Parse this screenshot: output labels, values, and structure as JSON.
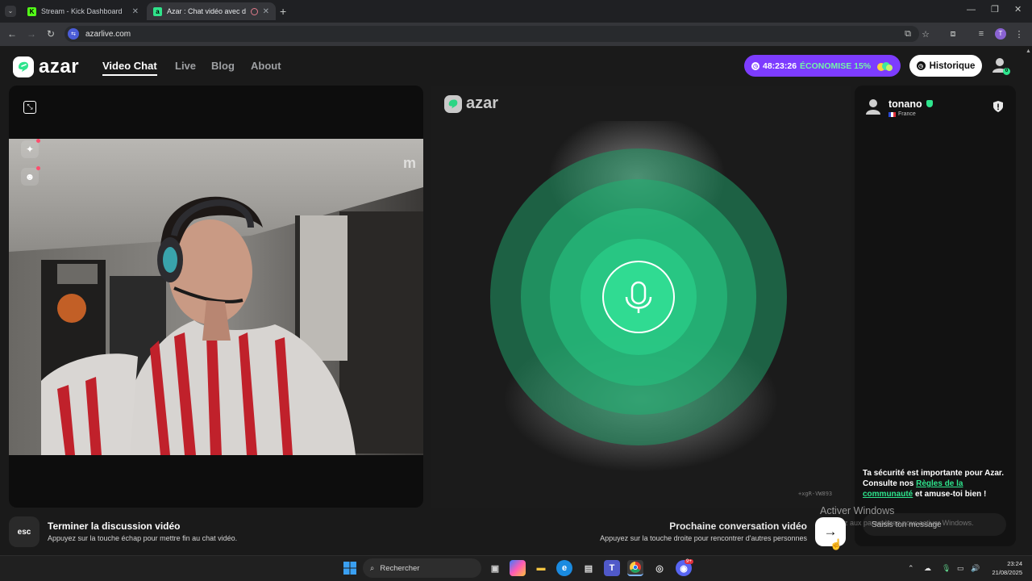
{
  "browser": {
    "tabs": [
      {
        "title": "Stream - Kick Dashboard",
        "favicon": "K",
        "color": "#53fc18",
        "active": false
      },
      {
        "title": "Azar : Chat vidéo avec de nouvelles",
        "favicon": "a",
        "color": "#2fe38a",
        "active": true
      }
    ],
    "new_tab": "+",
    "url": "azarlive.com",
    "profile_initial": "T"
  },
  "header": {
    "brand": "azar",
    "nav": [
      {
        "label": "Video Chat",
        "active": true
      },
      {
        "label": "Live",
        "active": false
      },
      {
        "label": "Blog",
        "active": false
      },
      {
        "label": "About",
        "active": false
      }
    ],
    "promo": {
      "timer": "48:23:26",
      "offer": "ÉCONOMISE 15%"
    },
    "history_label": "Historique",
    "profile_badge": "0"
  },
  "video": {
    "center_brand": "azar",
    "watermark": "m",
    "session_id": "+xgR-VW893"
  },
  "chat": {
    "peer_name": "tonano",
    "peer_country": "France",
    "safety": {
      "before": "Ta sécurité est importante pour Azar. Consulte nos ",
      "link": "Règles de la communauté",
      "after": " et amuse-toi bien !"
    },
    "input_placeholder": "Saisis ton message"
  },
  "footer": {
    "esc_key": "esc",
    "end_title": "Terminer la discussion vidéo",
    "end_sub": "Appuyez sur la touche échap pour mettre fin au chat vidéo.",
    "next_title": "Prochaine conversation vidéo",
    "next_sub": "Appuyez sur la touche droite pour rencontrer d'autres personnes"
  },
  "overlay": {
    "activate_title": "Activer Windows",
    "activate_sub": "Accédez aux paramètres pour activer Windows."
  },
  "taskbar": {
    "search_placeholder": "Rechercher",
    "time": "23:24",
    "date": "21/08/2025",
    "notification_count": "9+"
  },
  "colors": {
    "accent": "#2ee58d",
    "promo": "#7d3cff",
    "page_bg": "#1a1a1a"
  }
}
